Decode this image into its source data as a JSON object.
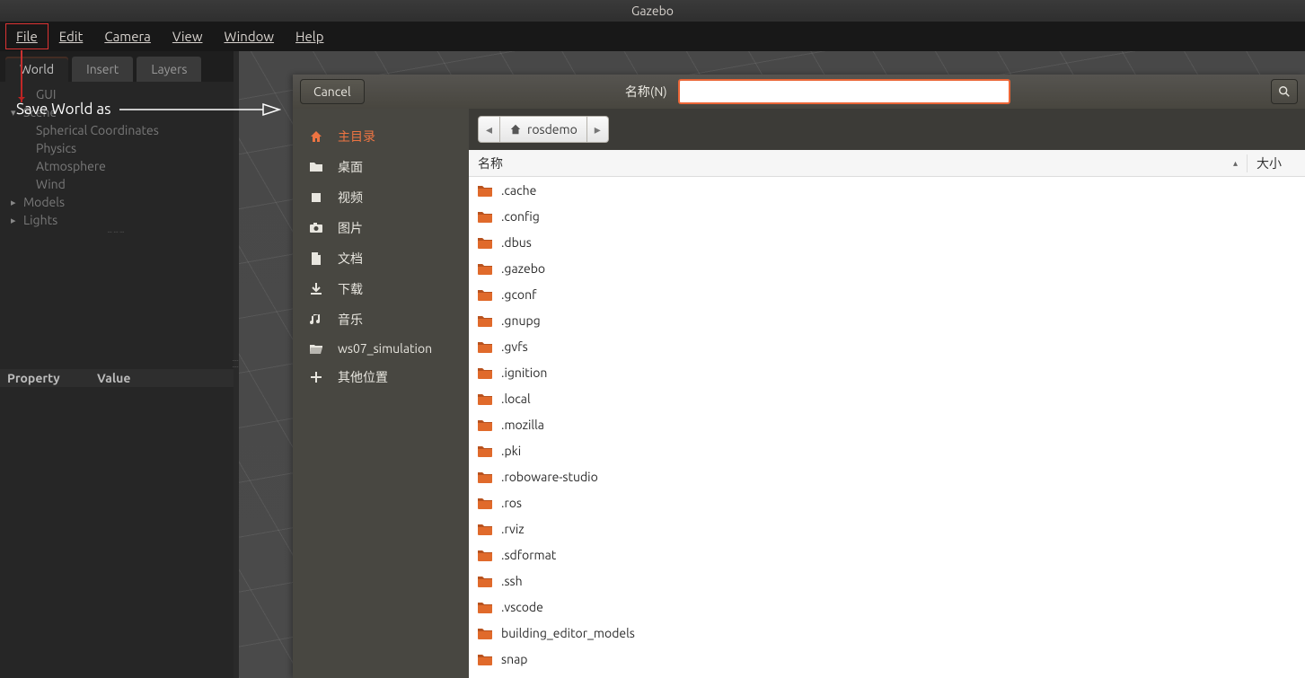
{
  "title": "Gazebo",
  "menu": {
    "file": "File",
    "edit": "Edit",
    "camera": "Camera",
    "view": "View",
    "window": "Window",
    "help": "Help"
  },
  "tabs": {
    "world": "World",
    "insert": "Insert",
    "layers": "Layers"
  },
  "tree": {
    "gui": "GUI",
    "scene": "Scene",
    "spherical": "Spherical Coordinates",
    "physics": "Physics",
    "atmosphere": "Atmosphere",
    "wind": "Wind",
    "models": "Models",
    "lights": "Lights"
  },
  "prop": {
    "property": "Property",
    "value": "Value"
  },
  "annotation": "Save World as",
  "dialog": {
    "cancel": "Cancel",
    "name_label": "名称(N)",
    "name_value": "",
    "breadcrumb": "rosdemo",
    "col_name": "名称",
    "col_size": "大小"
  },
  "places": [
    {
      "key": "home",
      "label": "主目录",
      "icon": "home",
      "active": true
    },
    {
      "key": "desktop",
      "label": "桌面",
      "icon": "folder"
    },
    {
      "key": "videos",
      "label": "视频",
      "icon": "video"
    },
    {
      "key": "pictures",
      "label": "图片",
      "icon": "camera"
    },
    {
      "key": "documents",
      "label": "文档",
      "icon": "doc"
    },
    {
      "key": "downloads",
      "label": "下载",
      "icon": "download"
    },
    {
      "key": "music",
      "label": "音乐",
      "icon": "music"
    },
    {
      "key": "ws07",
      "label": "ws07_simulation",
      "icon": "folderopen"
    },
    {
      "key": "other",
      "label": "其他位置",
      "icon": "plus"
    }
  ],
  "files": [
    ".cache",
    ".config",
    ".dbus",
    ".gazebo",
    ".gconf",
    ".gnupg",
    ".gvfs",
    ".ignition",
    ".local",
    ".mozilla",
    ".pki",
    ".roboware-studio",
    ".ros",
    ".rviz",
    ".sdformat",
    ".ssh",
    ".vscode",
    "building_editor_models",
    "snap"
  ]
}
